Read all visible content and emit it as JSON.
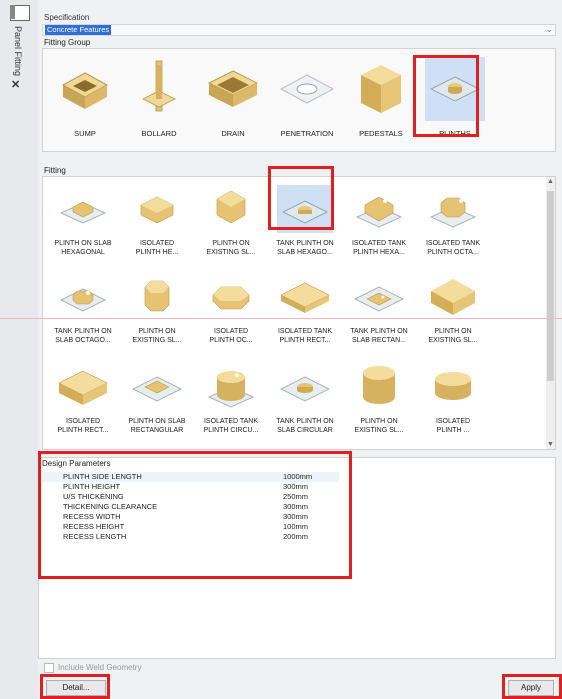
{
  "side_tab": {
    "label": "Panel Fitting"
  },
  "specification": {
    "label": "Specification",
    "value": "Concrete Features"
  },
  "fitting_group": {
    "label": "Fitting Group",
    "items": [
      {
        "label": "SUMP",
        "icon": "sump-icon"
      },
      {
        "label": "BOLLARD",
        "icon": "bollard-icon"
      },
      {
        "label": "DRAIN",
        "icon": "drain-icon"
      },
      {
        "label": "PENETRATION",
        "icon": "penetration-icon"
      },
      {
        "label": "PEDESTALS",
        "icon": "pedestal-icon"
      },
      {
        "label": "PLINTHS",
        "icon": "plinth-icon",
        "selected": true
      }
    ]
  },
  "fitting": {
    "label": "Fitting",
    "items": [
      {
        "label": "PLINTH ON SLAB\nHEXAGONAL"
      },
      {
        "label": "ISOLATED\nPLINTH HE..."
      },
      {
        "label": "PLINTH ON\nEXISTING SL..."
      },
      {
        "label": "TANK PLINTH ON\nSLAB HEXAGO...",
        "selected": true
      },
      {
        "label": "ISOLATED TANK\nPLINTH HEXA..."
      },
      {
        "label": "ISOLATED TANK\nPLINTH OCTA..."
      },
      {
        "label": "TANK PLINTH ON\nSLAB OCTAGO..."
      },
      {
        "label": "PLINTH ON\nEXISTING SL..."
      },
      {
        "label": "ISOLATED\nPLINTH OC..."
      },
      {
        "label": "ISOLATED TANK\nPLINTH RECT..."
      },
      {
        "label": "TANK PLINTH ON\nSLAB RECTAN..."
      },
      {
        "label": "PLINTH ON\nEXISTING SL..."
      },
      {
        "label": "ISOLATED\nPLINTH RECT..."
      },
      {
        "label": "PLINTH ON SLAB\nRECTANGULAR"
      },
      {
        "label": "ISOLATED TANK\nPLINTH CIRCU..."
      },
      {
        "label": "TANK PLINTH ON\nSLAB CIRCULAR"
      },
      {
        "label": "PLINTH ON\nEXISTING SL..."
      },
      {
        "label": "ISOLATED\nPLINTH ..."
      }
    ]
  },
  "design_parameters": {
    "label": "Design Parameters",
    "rows": [
      {
        "name": "PLINTH SIDE LENGTH",
        "value": "1000mm"
      },
      {
        "name": "PLINTH HEIGHT",
        "value": "300mm"
      },
      {
        "name": "U/S THICKENING",
        "value": "250mm"
      },
      {
        "name": "THICKENING CLEARANCE",
        "value": "300mm"
      },
      {
        "name": "RECESS WIDTH",
        "value": "300mm"
      },
      {
        "name": "RECESS HEIGHT",
        "value": "100mm"
      },
      {
        "name": "RECESS LENGTH",
        "value": "200mm"
      }
    ]
  },
  "weld": {
    "label": "Include Weld Geometry"
  },
  "buttons": {
    "detail": "Detail...",
    "apply": "Apply"
  },
  "colors": {
    "accent": "#2f6fd6",
    "highlight": "#e02020",
    "concrete": "#e8c878"
  }
}
